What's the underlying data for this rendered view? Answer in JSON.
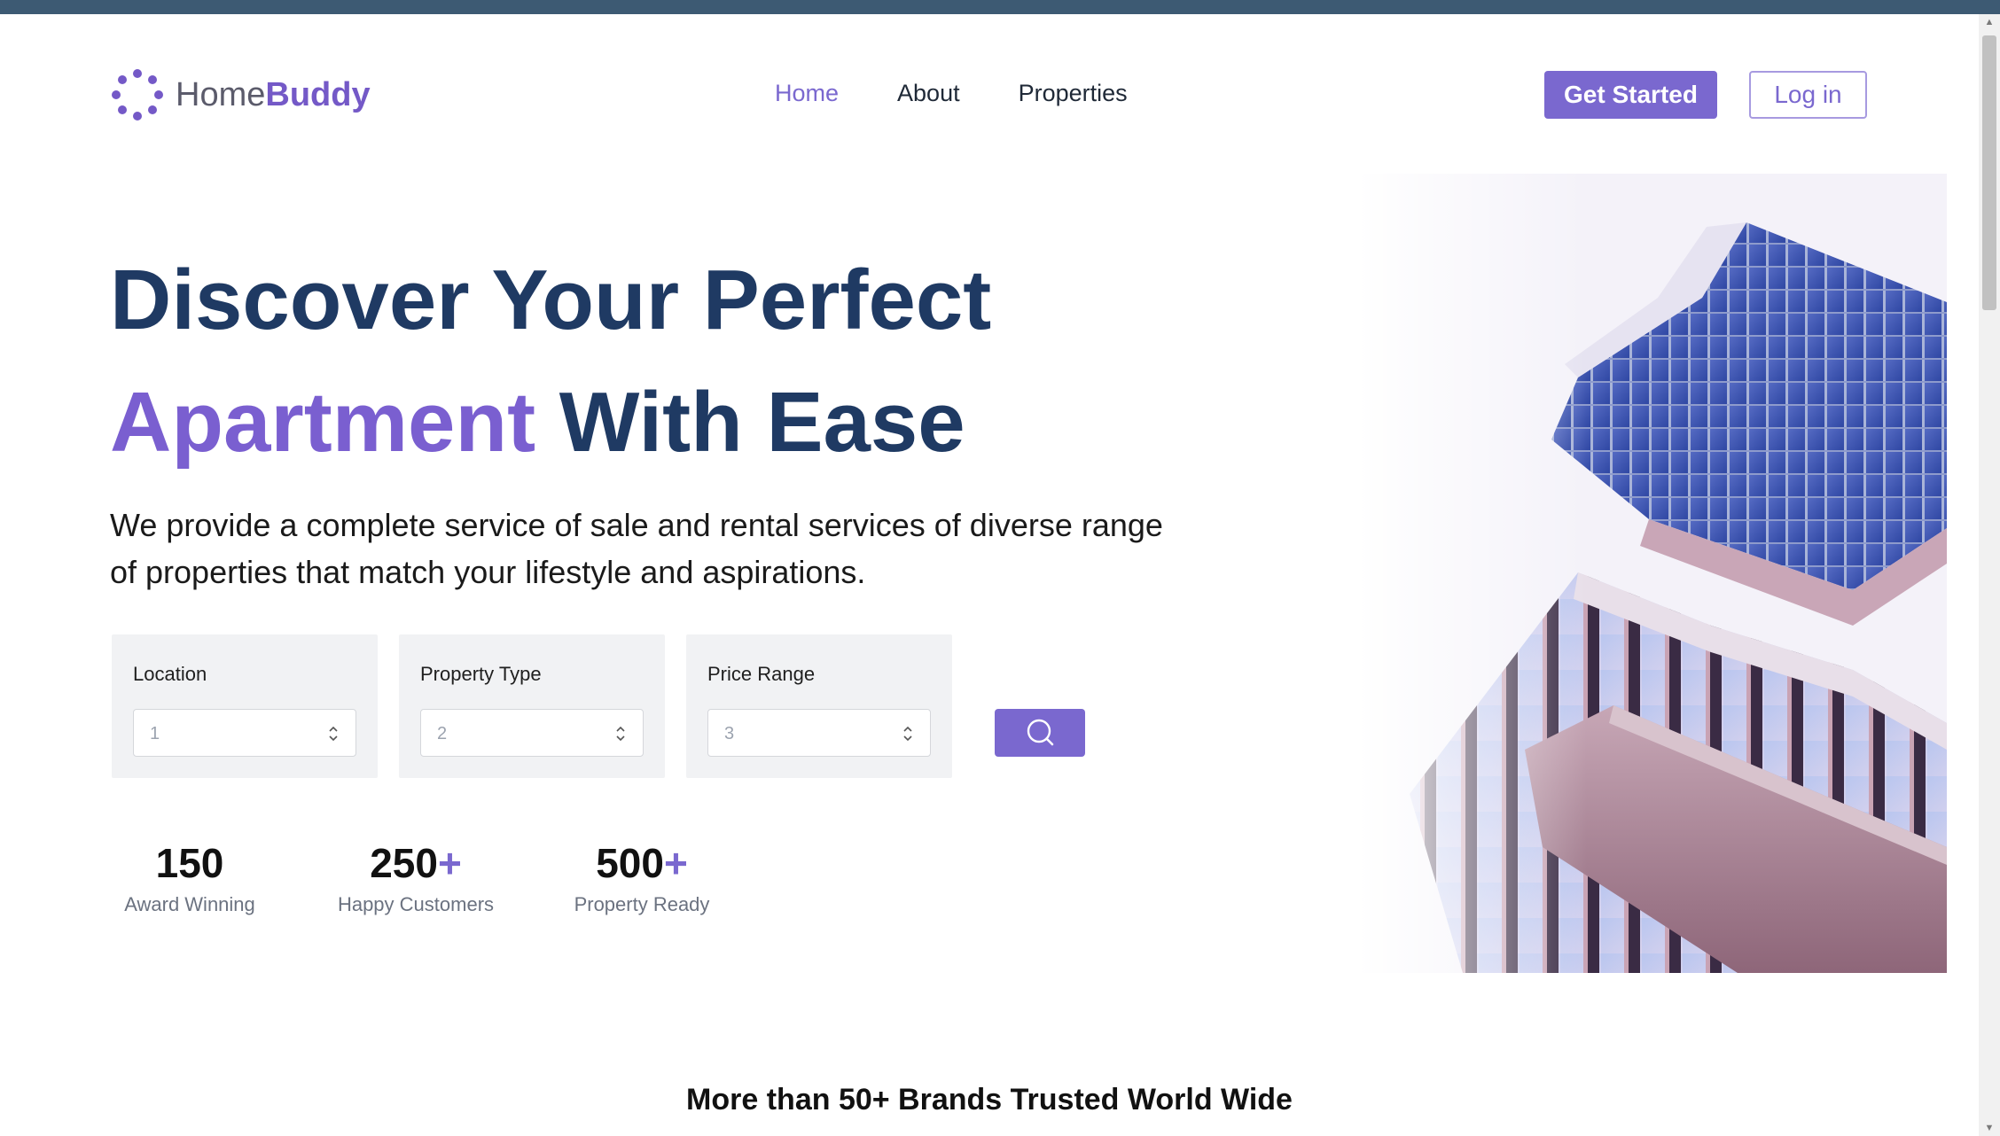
{
  "brand": {
    "name_light": "Home",
    "name_bold": "Buddy",
    "accent": "#7a68cf"
  },
  "nav": {
    "home": "Home",
    "about": "About",
    "properties": "Properties"
  },
  "actions": {
    "get_started": "Get Started",
    "login": "Log in"
  },
  "hero": {
    "title_line1": "Discover Your Perfect",
    "title_accent": "Apartment",
    "title_rest": "With Ease",
    "description": "We provide a complete service of sale and rental services of diverse range of properties that match your lifestyle and aspirations."
  },
  "filters": [
    {
      "label": "Location",
      "value": "1"
    },
    {
      "label": "Property Type",
      "value": "2"
    },
    {
      "label": "Price Range",
      "value": "3"
    }
  ],
  "search": {
    "icon": "search-icon"
  },
  "stats": [
    {
      "value": "150",
      "suffix": "",
      "label": "Award Winning"
    },
    {
      "value": "250",
      "suffix": "+",
      "label": "Happy Customers"
    },
    {
      "value": "500",
      "suffix": "+",
      "label": "Property Ready"
    }
  ],
  "brands_heading": "More than 50+ Brands Trusted World Wide",
  "colors": {
    "heading": "#1f3a63",
    "topbar": "#3d5a73",
    "filter_bg": "#f1f2f4"
  }
}
